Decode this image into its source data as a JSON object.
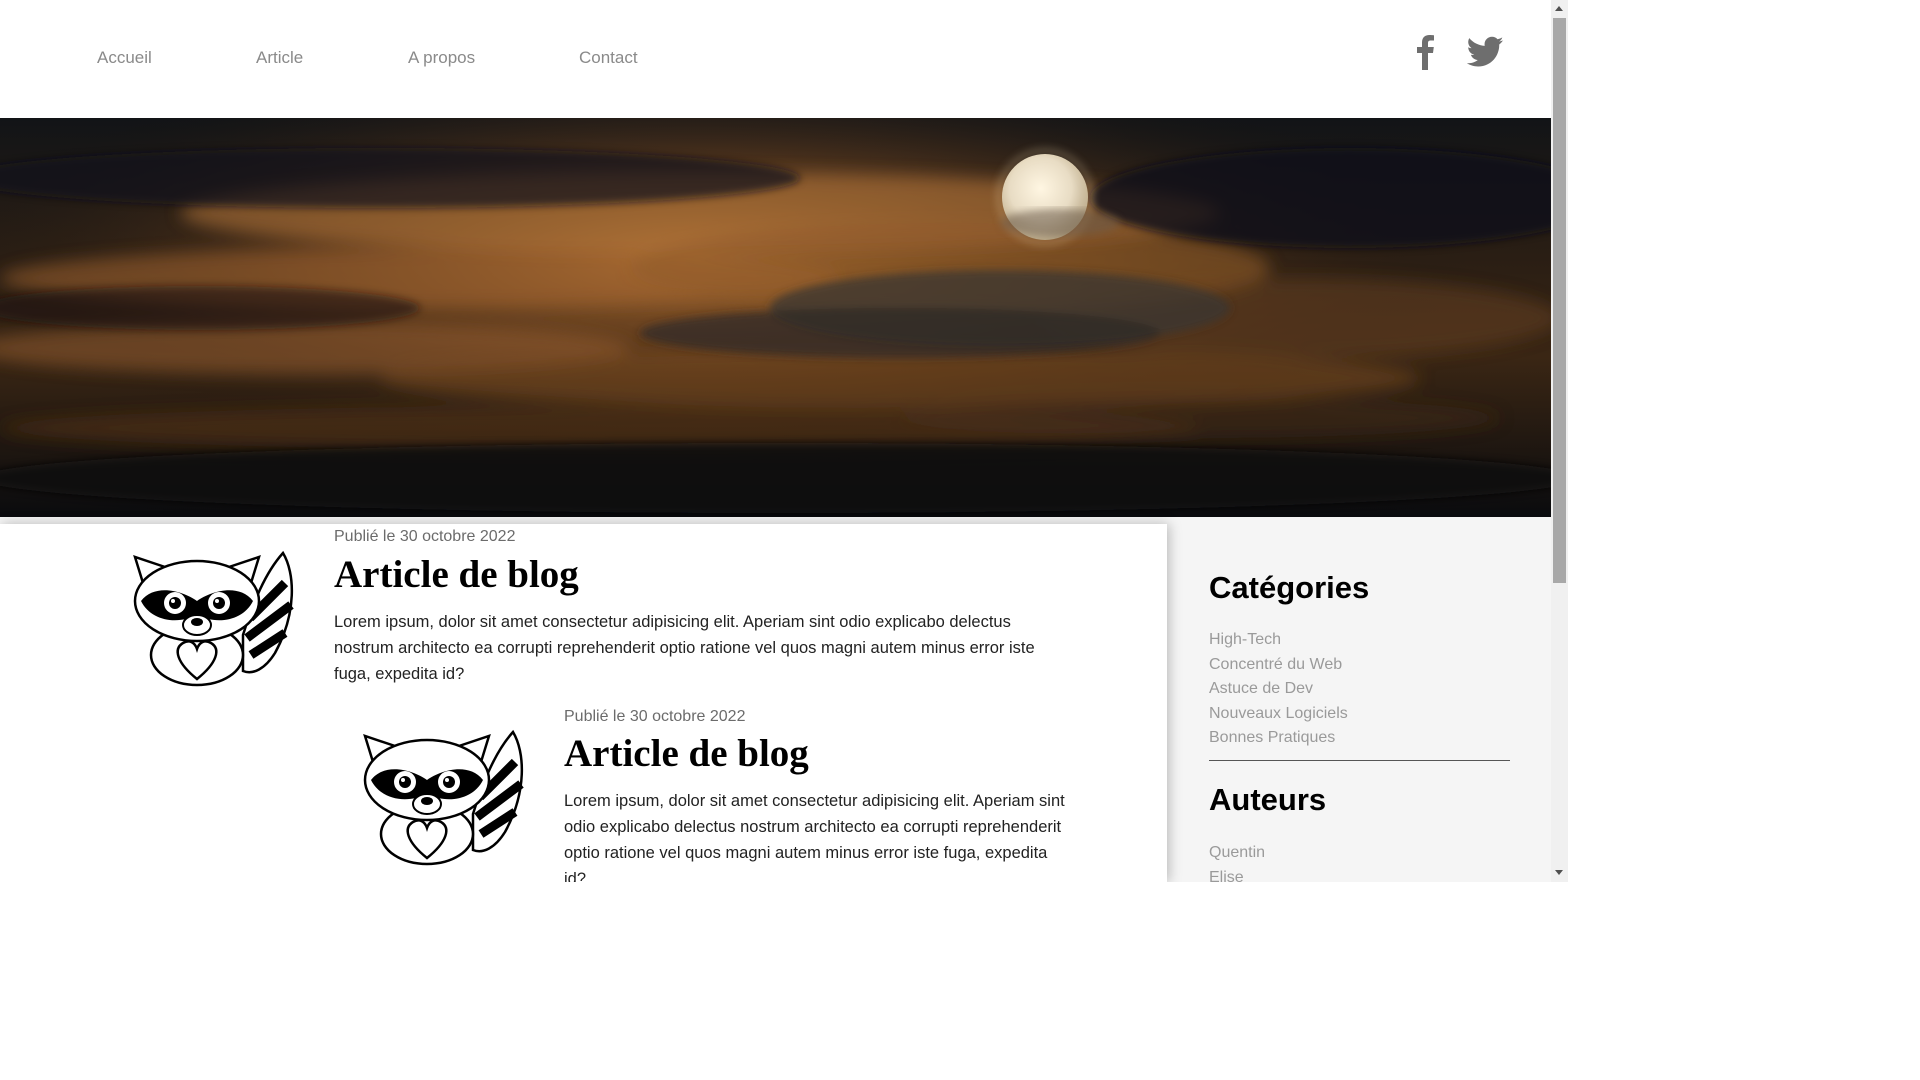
{
  "nav": {
    "items": [
      {
        "label": "Accueil"
      },
      {
        "label": "Article"
      },
      {
        "label": "A propos"
      },
      {
        "label": "Contact"
      }
    ]
  },
  "social": {
    "icons": [
      "facebook-icon",
      "twitter-icon"
    ],
    "icon_color": "#6e6e6e"
  },
  "hero": {
    "image": "moon-clouds-night-sky"
  },
  "posts": [
    {
      "date": "Publié le 30 octobre 2022",
      "title": "Article de blog",
      "text": "Lorem ipsum, dolor sit amet consectetur adipisicing elit. Aperiam sint odio explicabo delectus nostrum architecto ea corrupti reprehenderit optio ratione vel quos magni autem minus error iste fuga, expedita id?",
      "image": "raccoon-heart"
    },
    {
      "date": "Publié le 30 octobre 2022",
      "title": "Article de blog",
      "text": "Lorem ipsum, dolor sit amet consectetur adipisicing elit. Aperiam sint odio explicabo delectus nostrum architecto ea corrupti reprehenderit optio ratione vel quos magni autem minus error iste fuga, expedita id?",
      "image": "raccoon-heart"
    }
  ],
  "sidebar": {
    "categories_title": "Catégories",
    "categories": [
      "High-Tech",
      "Concentré du Web",
      "Astuce de Dev",
      "Nouveaux Logiciels",
      "Bonnes Pratiques"
    ],
    "authors_title": "Auteurs",
    "authors": [
      "Quentin",
      "Elise"
    ]
  },
  "colors": {
    "nav_link": "#8a8a8a",
    "sidebar_bg": "#f5f5f5",
    "sidebar_link": "#9a9a9a"
  }
}
